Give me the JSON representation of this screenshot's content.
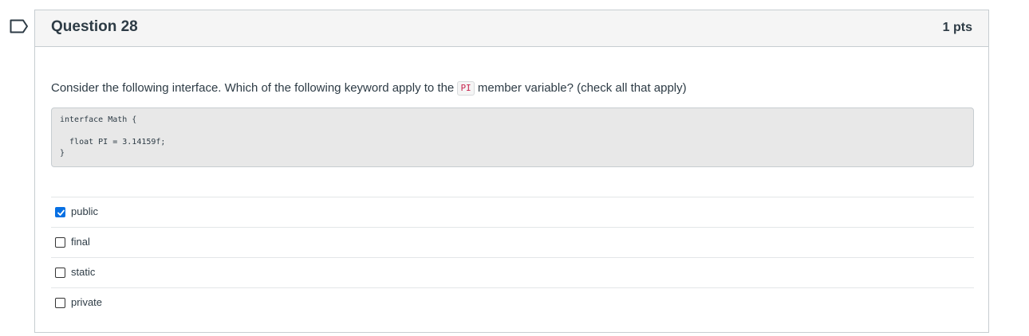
{
  "question": {
    "title": "Question 28",
    "points": "1 pts",
    "text_before": "Consider the following interface. Which of the following keyword apply to the ",
    "inline_code": "PI",
    "text_after": " member variable? (check all that apply)",
    "code_lines": [
      "interface Math {",
      "  float PI = 3.14159f;",
      "}"
    ]
  },
  "answers": [
    {
      "label": "public",
      "checked": true
    },
    {
      "label": "final",
      "checked": false
    },
    {
      "label": "static",
      "checked": false
    },
    {
      "label": "private",
      "checked": false
    }
  ],
  "colors": {
    "accent": "#0770e3",
    "header_bg": "#f5f5f5",
    "code_bg": "#e8e8e8",
    "inline_code_text": "#c7254e"
  }
}
